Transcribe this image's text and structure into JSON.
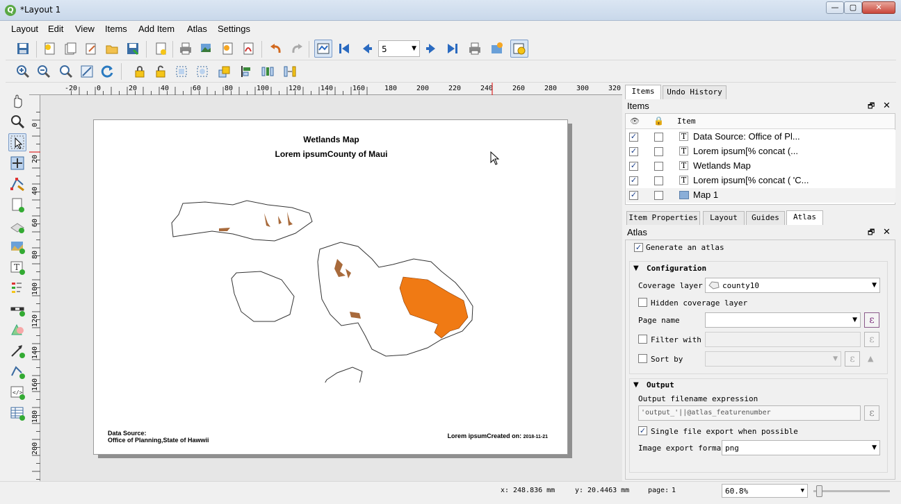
{
  "window": {
    "title": "*Layout 1",
    "app_icon": "Q",
    "minimize": "—",
    "maximize": "▢",
    "close": "✕"
  },
  "menu": [
    "Layout",
    "Edit",
    "View",
    "Items",
    "Add Item",
    "Atlas",
    "Settings"
  ],
  "atlas_toolbar": {
    "page_value": "5"
  },
  "ruler_top": {
    "labels": [
      "-20",
      "0",
      "20",
      "40",
      "60",
      "80",
      "100",
      "120",
      "140",
      "160",
      "180",
      "200",
      "220",
      "240",
      "260",
      "280",
      "300",
      "320"
    ]
  },
  "ruler_left": {
    "labels": [
      "0",
      "20",
      "40",
      "60",
      "80",
      "100",
      "120",
      "140",
      "160",
      "180",
      "200"
    ]
  },
  "layout_page": {
    "title": "Wetlands Map",
    "subtitle": "Lorem ipsumCounty of Maui",
    "data_source_label": "Data Source:",
    "data_source_value": "Office of Planning,State of Hawwii",
    "created_prefix": "Lorem ipsumCreated on: ",
    "created_date": "2018-11-21"
  },
  "right_panel": {
    "tabs_top": [
      "Items",
      "Undo History"
    ],
    "items_header": "Items",
    "items_columns": {
      "item": "Item"
    },
    "items": [
      {
        "label": "Data Source: Office of Pl...",
        "type": "T"
      },
      {
        "label": "Lorem ipsum[% concat (...",
        "type": "T"
      },
      {
        "label": "Wetlands Map",
        "type": "T"
      },
      {
        "label": "Lorem ipsum[% concat ( 'C...",
        "type": "T"
      },
      {
        "label": "Map 1",
        "type": "map"
      }
    ],
    "tabs_bottom": [
      "Item Properties",
      "Layout",
      "Guides",
      "Atlas"
    ],
    "atlas_header": "Atlas",
    "generate_atlas": "Generate an atlas",
    "configuration": {
      "heading": "Configuration",
      "coverage_layer_label": "Coverage layer",
      "coverage_layer_value": "county10",
      "hidden_coverage_layer": "Hidden coverage layer",
      "page_name_label": "Page name",
      "filter_with_label": "Filter with",
      "sort_by_label": "Sort by",
      "expression_glyph": "ε"
    },
    "output": {
      "heading": "Output",
      "filename_label": "Output filename expression",
      "filename_value": "'output_'||@atlas_featurenumber",
      "single_file": "Single file export when possible",
      "format_label": "Image export format",
      "format_value": "png"
    }
  },
  "status": {
    "x_label": "x:",
    "x_value": "248.836 mm",
    "y_label": "y:",
    "y_value": "20.4463 mm",
    "page_label": "page:",
    "page_value": "1",
    "zoom_value": "60.8%"
  }
}
